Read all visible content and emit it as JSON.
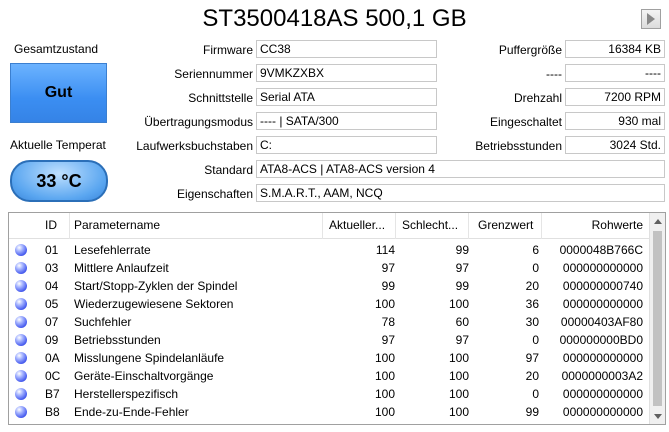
{
  "title": "ST3500418AS 500,1 GB",
  "health": {
    "label": "Gesamtzustand",
    "value": "Gut"
  },
  "temperature": {
    "label": "Aktuelle Temperat",
    "value": "33 °C"
  },
  "info_left": [
    {
      "label": "Firmware",
      "value": "CC38"
    },
    {
      "label": "Seriennummer",
      "value": "9VMKZXBX"
    },
    {
      "label": "Schnittstelle",
      "value": "Serial ATA"
    },
    {
      "label": "Übertragungsmodus",
      "value": "---- | SATA/300"
    },
    {
      "label": "Laufwerksbuchstaben",
      "value": "C:"
    }
  ],
  "info_right": [
    {
      "label": "Puffergröße",
      "value": "16384 KB"
    },
    {
      "label": "----",
      "value": "----"
    },
    {
      "label": "Drehzahl",
      "value": "7200 RPM"
    },
    {
      "label": "Eingeschaltet",
      "value": "930 mal"
    },
    {
      "label": "Betriebsstunden",
      "value": "3024 Std."
    }
  ],
  "standard": {
    "label": "Standard",
    "value": "ATA8-ACS | ATA8-ACS version 4"
  },
  "features": {
    "label": "Eigenschaften",
    "value": "S.M.A.R.T., AAM, NCQ"
  },
  "table": {
    "headers": [
      "ID",
      "Parametername",
      "Aktueller...",
      "Schlecht...",
      "Grenzwert",
      "Rohwerte"
    ],
    "rows": [
      {
        "id": "01",
        "name": "Lesefehlerrate",
        "current": "114",
        "worst": "99",
        "threshold": "6",
        "raw": "0000048B766C"
      },
      {
        "id": "03",
        "name": "Mittlere Anlaufzeit",
        "current": "97",
        "worst": "97",
        "threshold": "0",
        "raw": "000000000000"
      },
      {
        "id": "04",
        "name": "Start/Stopp-Zyklen der Spindel",
        "current": "99",
        "worst": "99",
        "threshold": "20",
        "raw": "000000000740"
      },
      {
        "id": "05",
        "name": "Wiederzugewiesene Sektoren",
        "current": "100",
        "worst": "100",
        "threshold": "36",
        "raw": "000000000000"
      },
      {
        "id": "07",
        "name": "Suchfehler",
        "current": "78",
        "worst": "60",
        "threshold": "30",
        "raw": "00000403AF80"
      },
      {
        "id": "09",
        "name": "Betriebsstunden",
        "current": "97",
        "worst": "97",
        "threshold": "0",
        "raw": "000000000BD0"
      },
      {
        "id": "0A",
        "name": "Misslungene Spindelanläufe",
        "current": "100",
        "worst": "100",
        "threshold": "97",
        "raw": "000000000000"
      },
      {
        "id": "0C",
        "name": "Geräte-Einschaltvorgänge",
        "current": "100",
        "worst": "100",
        "threshold": "20",
        "raw": "0000000003A2"
      },
      {
        "id": "B7",
        "name": "Herstellerspezifisch",
        "current": "100",
        "worst": "100",
        "threshold": "0",
        "raw": "000000000000"
      },
      {
        "id": "B8",
        "name": "Ende-zu-Ende-Fehler",
        "current": "100",
        "worst": "100",
        "threshold": "99",
        "raw": "000000000000"
      }
    ]
  },
  "colors": {
    "health_bg": "#3b8ef2",
    "temp_bg": "#5aa6f0",
    "status_dot": "#4a5ff0"
  }
}
